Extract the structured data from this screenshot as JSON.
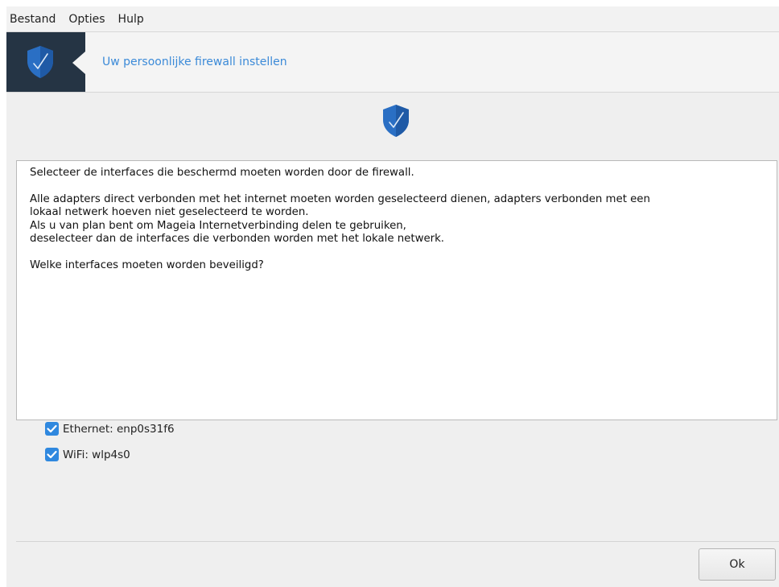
{
  "menubar": {
    "items": [
      "Bestand",
      "Opties",
      "Hulp"
    ]
  },
  "banner": {
    "title": "Uw persoonlijke firewall instellen",
    "icon": "shield-check-icon"
  },
  "main": {
    "icon": "shield-check-icon",
    "intro": "Selecteer de interfaces die beschermd moeten worden door de firewall.",
    "paragraph_lines": [
      "Alle adapters direct verbonden met het internet moeten worden geselecteerd dienen, adapters verbonden met een",
      "lokaal netwerk hoeven niet geselecteerd te worden.",
      "Als u van plan bent om Mageia Internetverbinding delen te gebruiken,",
      "deselecteer dan de interfaces die verbonden worden met het lokale netwerk."
    ],
    "question": "Welke interfaces moeten worden beveiligd?"
  },
  "interfaces": [
    {
      "label": "Ethernet: enp0s31f6",
      "checked": true
    },
    {
      "label": "WiFi: wlp4s0",
      "checked": true
    }
  ],
  "footer": {
    "ok_label": "Ok"
  },
  "colors": {
    "banner_dark": "#253444",
    "accent": "#3b8ad8",
    "checkbox": "#2f88df",
    "shield": "#2a6fc4"
  }
}
